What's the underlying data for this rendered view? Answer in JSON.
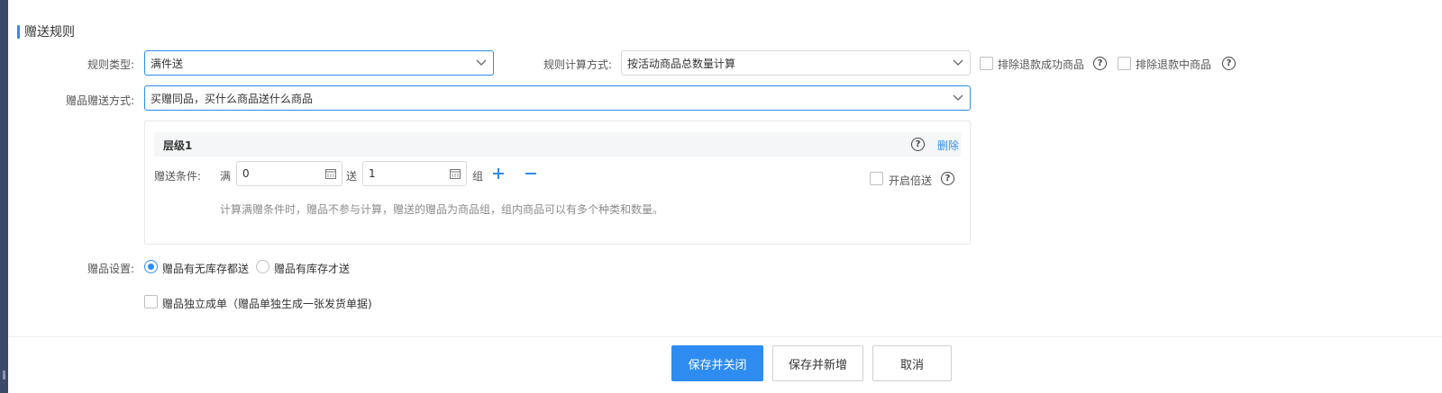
{
  "section": {
    "title": "赠送规则"
  },
  "rule_type": {
    "label": "规则类型:",
    "value": "满件送"
  },
  "calc_method": {
    "label": "规则计算方式:",
    "value": "按活动商品总数量计算"
  },
  "exclude_refund_success": {
    "label": "排除退款成功商品",
    "checked": false
  },
  "exclude_refunding": {
    "label": "排除退款中商品",
    "checked": false
  },
  "gift_method": {
    "label": "赠品赠送方式:",
    "value": "买赠同品，买什么商品送什么商品"
  },
  "tier": {
    "title": "层级1",
    "delete_label": "删除",
    "condition_label": "赠送条件:",
    "full_label": "满",
    "full_value": "0",
    "send_label": "送",
    "send_value": "1",
    "group_label": "组",
    "double_label": "开启倍送",
    "hint": "计算满赠条件时，赠品不参与计算，赠送的赠品为商品组，组内商品可以有多个种类和数量。"
  },
  "gift_settings": {
    "label": "赠品设置:",
    "options": [
      "赠品有无库存都送",
      "赠品有库存才送"
    ],
    "selected": "赠品有无库存都送"
  },
  "standalone_order": {
    "label": "赠品独立成单（赠品单独生成一张发货单据)",
    "checked": false
  },
  "footer": {
    "save_close": "保存并关闭",
    "save_new": "保存并新增",
    "cancel": "取消"
  },
  "colors": {
    "accent": "#2e8cf0",
    "border": "#d9d9d9"
  },
  "icons": {
    "help": "question-circle-icon",
    "caret": "chevron-down-icon",
    "calendar": "calendar-icon",
    "plus": "plus-icon",
    "minus": "minus-icon"
  }
}
